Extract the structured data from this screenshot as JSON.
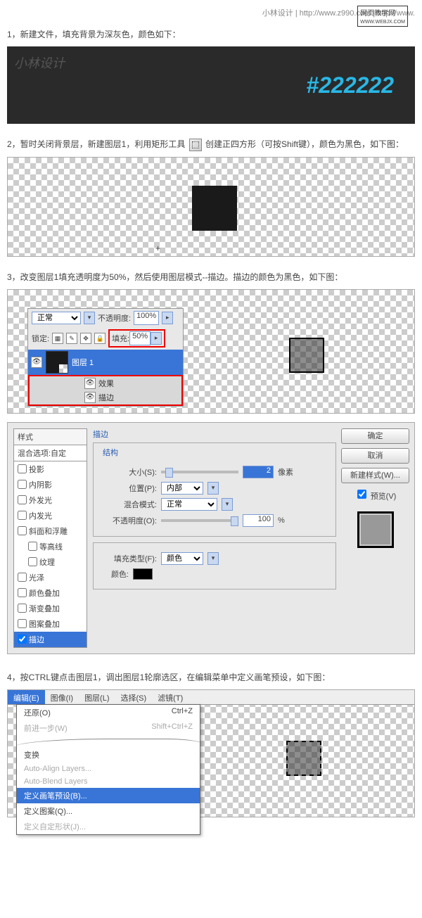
{
  "header": {
    "left": "小林设计 | http://www.z990.com | http://www.",
    "brand": "网页教学网",
    "brandsub": "WWW.WEBJX.COM"
  },
  "step1": "1，新建文件，填充背景为深灰色，颜色如下：",
  "swatch": {
    "wm": "小林设计",
    "hex": "#222222"
  },
  "step2_a": "2，暂时关闭背景层，新建图层1，利用矩形工具",
  "step2_b": "创建正四方形（可按Shift键），颜色为黑色，如下图：",
  "step3": "3，改变图层1填充透明度为50%，然后使用图层模式--描边。描边的颜色为黑色，如下图：",
  "layers": {
    "mode": "正常",
    "opacity_lbl": "不透明度:",
    "opacity": "100%",
    "lock_lbl": "锁定:",
    "fill_lbl": "填充:",
    "fill": "50%",
    "layer1": "图层 1",
    "fx": "效果",
    "stroke": "描边"
  },
  "dialog": {
    "styles_hd": "样式",
    "styles_sub": "混合选项:自定",
    "items": [
      "投影",
      "内阴影",
      "外发光",
      "内发光",
      "斜面和浮雕",
      "等高线",
      "纹理",
      "光泽",
      "颜色叠加",
      "渐变叠加",
      "图案叠加",
      "描边"
    ],
    "stroke_title": "描边",
    "struct": "结构",
    "size_lbl": "大小(S):",
    "size_val": "2",
    "px": "像素",
    "pos_lbl": "位置(P):",
    "pos_val": "内部",
    "blend_lbl": "混合模式:",
    "blend_val": "正常",
    "opac_lbl": "不透明度(O):",
    "opac_val": "100",
    "pct": "%",
    "filltype_lbl": "填充类型(F):",
    "filltype_val": "颜色",
    "color_lbl": "颜色:",
    "ok": "确定",
    "cancel": "取消",
    "newstyle": "新建样式(W)...",
    "preview": "预览(V)"
  },
  "step4": "4，按CTRL键点击图层1，调出图层1轮廓选区，在编辑菜单中定义画笔预设，如下图：",
  "menu": {
    "bar": [
      "编辑(E)",
      "图像(I)",
      "图层(L)",
      "选择(S)",
      "滤镜(T)"
    ],
    "undo": "还原(O)",
    "undo_k": "Ctrl+Z",
    "step": "前进一步(W)",
    "step_k": "Shift+Ctrl+Z",
    "trans": "变换",
    "aal": "Auto-Align Layers...",
    "abl": "Auto-Blend Layers",
    "brush": "定义画笔预设(B)...",
    "pattern": "定义图案(Q)...",
    "shape": "定义自定形状(J)..."
  }
}
